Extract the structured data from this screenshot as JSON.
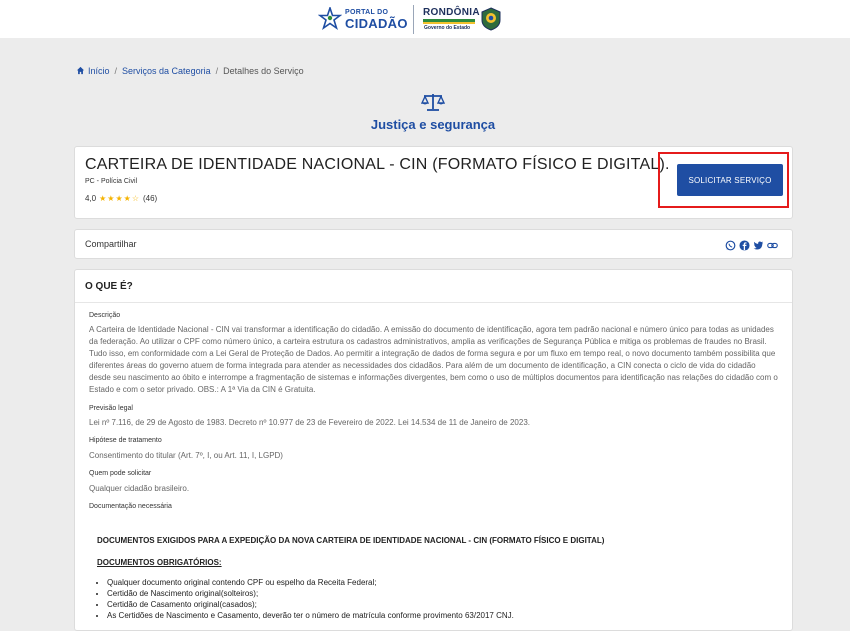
{
  "header": {
    "portal_small": "PORTAL DO",
    "portal_big": "CIDADÃO",
    "state_name": "RONDÔNIA",
    "state_sub": "Governo do Estado"
  },
  "breadcrumb": {
    "home": "Início",
    "category": "Serviços da Categoria",
    "current": "Detalhes do Serviço"
  },
  "category": {
    "title": "Justiça e segurança",
    "icon": "scales-icon"
  },
  "service": {
    "title": "CARTEIRA DE IDENTIDADE NACIONAL - CIN (FORMATO FÍSICO E DIGITAL).",
    "org": "PC - Polícia Civil",
    "rating_value": "4,0",
    "rating_stars": 4,
    "rating_count": "(46)",
    "button_label": "SOLICITAR SERVIÇO"
  },
  "share": {
    "label": "Compartilhar",
    "icons": [
      "whatsapp-icon",
      "facebook-icon",
      "twitter-icon",
      "link-icon"
    ]
  },
  "main": {
    "heading": "O QUE É?",
    "description_label": "Descrição",
    "description": "A Carteira de Identidade Nacional - CIN vai transformar a identificação do cidadão. A emissão do documento de identificação, agora tem padrão nacional e número único para todas as unidades da federação. Ao utilizar o CPF como número único, a carteira estrutura os cadastros administrativos, amplia as verificações de Segurança Pública e mitiga os problemas de fraudes no Brasil. Tudo isso, em conformidade com a Lei Geral de Proteção de Dados. Ao permitir a integração de dados de forma segura e por um fluxo em tempo real, o novo documento também possibilita que diferentes áreas do governo atuem de forma integrada para atender as necessidades dos cidadãos. Para além de um documento de identificação, a CIN conecta o ciclo de vida do cidadão desde seu nascimento ao óbito e interrompe a fragmentação de sistemas e informações divergentes, bem como o uso de múltiplos documentos para identificação nas relações do cidadão com o Estado e com o setor privado. OBS.: A 1ª Via da CIN é Gratuita.",
    "legal_label": "Previsão legal",
    "legal": "Lei nº 7.116, de 29 de Agosto de 1983. Decreto nº 10.977 de 23 de Fevereiro de 2022. Lei 14.534 de 11 de Janeiro de 2023.",
    "hypothesis_label": "Hipótese de tratamento",
    "hypothesis": "Consentimento do titular (Art. 7º, I, ou Art. 11, I, LGPD)",
    "who_label": "Quem pode solicitar",
    "who": "Qualquer cidadão brasileiro.",
    "docs_label": "Documentação necessária",
    "docs_title": "DOCUMENTOS EXIGIDOS PARA A EXPEDIÇÃO DA NOVA CARTEIRA DE IDENTIDADE NACIONAL - CIN (FORMATO FÍSICO E DIGITAL)",
    "docs_sub": "DOCUMENTOS OBRIGATÓRIOS:",
    "docs_list": [
      "Qualquer documento original contendo CPF ou espelho da Receita Federal;",
      "Certidão de Nascimento original(solteiros);",
      "Certidão de Casamento original(casados);",
      "As Certidões de Nascimento e Casamento, deverão ter o número de matrícula conforme provimento 63/2017 CNJ."
    ]
  },
  "colors": {
    "primary": "#1f4ea3",
    "highlight": "#e51b1b",
    "star": "#f5b301"
  }
}
